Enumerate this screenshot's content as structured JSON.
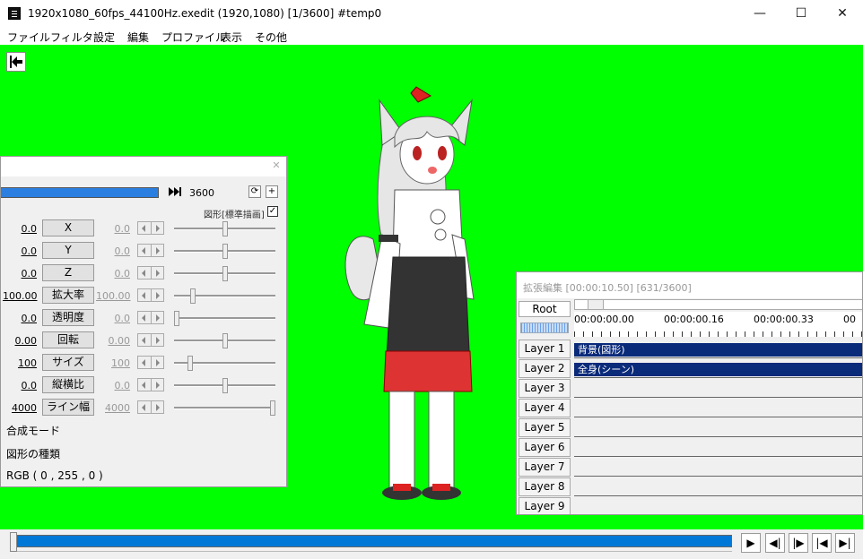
{
  "window": {
    "title": "1920x1080_60fps_44100Hz.exedit (1920,1080)  [1/3600]  #temp0",
    "minimize": "—",
    "maximize": "☐",
    "close": "✕"
  },
  "menu": [
    "ファイル",
    "フィルタ",
    "設定",
    "編集",
    "プロファイル",
    "表示",
    "その他"
  ],
  "canvas": {
    "background": "#00ff00",
    "back_icon": "⇤"
  },
  "settings_panel": {
    "close": "✕",
    "end_frame": "3600",
    "shape_label": "図形[標準描画]",
    "shape_checked": "✓",
    "rows": [
      {
        "value": "0.0",
        "label": "X",
        "value2": "0.0",
        "slider": 0.5
      },
      {
        "value": "0.0",
        "label": "Y",
        "value2": "0.0",
        "slider": 0.5
      },
      {
        "value": "0.0",
        "label": "Z",
        "value2": "0.0",
        "slider": 0.5
      },
      {
        "value": "100.00",
        "label": "拡大率",
        "value2": "100.00",
        "slider": 0.17
      },
      {
        "value": "0.0",
        "label": "透明度",
        "value2": "0.0",
        "slider": 0.0
      },
      {
        "value": "0.00",
        "label": "回転",
        "value2": "0.00",
        "slider": 0.5
      },
      {
        "value": "100",
        "label": "サイズ",
        "value2": "100",
        "slider": 0.14
      },
      {
        "value": "0.0",
        "label": "縦横比",
        "value2": "0.0",
        "slider": 0.5
      },
      {
        "value": "4000",
        "label": "ライン幅",
        "value2": "4000",
        "slider": 1.0
      }
    ],
    "blend_mode": "合成モード",
    "shape_type": "図形の種類",
    "color": "RGB ( 0 , 255 , 0 )"
  },
  "timeline": {
    "title": "拡張編集 [00:00:10.50] [631/3600]",
    "root": "Root",
    "ticks": [
      "00:00:00.00",
      "00:00:00.16",
      "00:00:00.33",
      "00"
    ],
    "layers": [
      "Layer 1",
      "Layer 2",
      "Layer 3",
      "Layer 4",
      "Layer 5",
      "Layer 6",
      "Layer 7",
      "Layer 8",
      "Layer 9"
    ],
    "objects": [
      {
        "layer": 1,
        "label": "背景(図形)"
      },
      {
        "layer": 2,
        "label": "全身(シーン)"
      }
    ]
  },
  "playback": {
    "play": "▶",
    "prev": "◀|",
    "next": "|▶",
    "start": "|◀",
    "end": "▶|"
  }
}
